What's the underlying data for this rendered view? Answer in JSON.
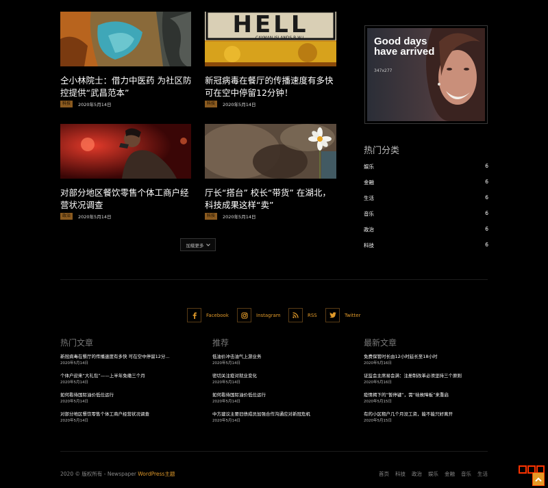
{
  "articles": [
    {
      "title": "仝小林院士：借力中医药 为社区防控提供“武昌范本”",
      "tag": "科技",
      "date": "2020年5月14日"
    },
    {
      "title": "新冠病毒在餐厅的传播速度有多快 可在空中停留12分钟！",
      "tag": "科技",
      "date": "2020年5月14日"
    },
    {
      "title": "对部分地区餐饮零售个体工商户经营状况调查",
      "tag": "政治",
      "date": "2020年5月14日"
    },
    {
      "title": "厅长“搭台” 校长“带货” 在湖北，科技成果这样“卖”",
      "tag": "科技",
      "date": "2020年5月14日"
    }
  ],
  "thumb2_sign": {
    "letters": "HELL",
    "caption": "CAYMAN ISLANDS B.W.I."
  },
  "load_more": "加载更多",
  "ad": {
    "heading": "Good days have arrived",
    "size": "347x277"
  },
  "sidebar": {
    "title": "热门分类",
    "categories": [
      {
        "name": "娱乐",
        "count": "6"
      },
      {
        "name": "金融",
        "count": "6"
      },
      {
        "name": "生活",
        "count": "6"
      },
      {
        "name": "音乐",
        "count": "6"
      },
      {
        "name": "政治",
        "count": "6"
      },
      {
        "name": "科技",
        "count": "6"
      }
    ]
  },
  "social": [
    {
      "label": "Facebook",
      "icon": "facebook-icon"
    },
    {
      "label": "Instagram",
      "icon": "instagram-icon"
    },
    {
      "label": "RSS",
      "icon": "rss-icon"
    },
    {
      "label": "Twitter",
      "icon": "twitter-icon"
    }
  ],
  "footer": {
    "columns": [
      {
        "title": "热门文章",
        "items": [
          {
            "title": "新冠病毒在餐厅的传播速度有多快 可在空中停留12分...",
            "date": "2020年5月14日"
          },
          {
            "title": "个体户迎来“大礼包”——上半年免缴三个月",
            "date": "2020年5月14日"
          },
          {
            "title": "如何看待国际油价低位运行",
            "date": "2020年5月14日"
          },
          {
            "title": "对部分地区餐饮零售个体工商户经营状况调查",
            "date": "2020年5月14日"
          }
        ]
      },
      {
        "title": "推荐",
        "items": [
          {
            "title": "低油价冲击油气上游业务",
            "date": "2020年5月14日"
          },
          {
            "title": "密切关注疫对就业变化",
            "date": "2020年5月14日"
          },
          {
            "title": "如何看待国际油价低位运行",
            "date": "2020年5月14日"
          },
          {
            "title": "中方建议主要旧债成员加强合作沟通应对新冠危机",
            "date": "2020年5月14日"
          }
        ]
      },
      {
        "title": "最新文章",
        "items": [
          {
            "title": "免费保管时长由12小时延长至18小时",
            "date": "2020年5月16日"
          },
          {
            "title": "证监会主席易会满：注册制改革必须坚持三个原则",
            "date": "2020年5月16日"
          },
          {
            "title": "疫情揭下的“暂停键”，需“硅故障板”来重启",
            "date": "2020年5月15日"
          },
          {
            "title": "有的小区租户几个月没工资，能不能只好离开",
            "date": "2020年5月15日"
          }
        ]
      }
    ],
    "copyright": "2020 © 版权所有 - Newspaper ",
    "copyright_link": "WordPress主题",
    "nav": [
      "首页",
      "科技",
      "政治",
      "娱乐",
      "金融",
      "音乐",
      "生活"
    ]
  },
  "colors": {
    "accent": "#e19a2a",
    "tag_bg": "#8a5a1f",
    "background": "#000000"
  }
}
